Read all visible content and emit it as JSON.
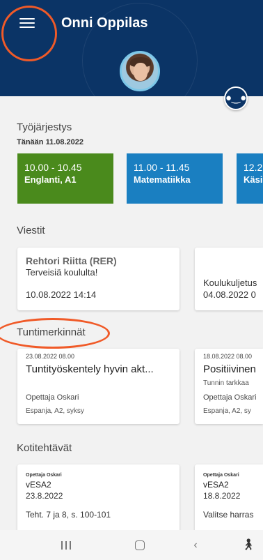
{
  "header": {
    "title": "Onni Oppilas"
  },
  "timetable": {
    "title": "Työjärjestys",
    "subtitle": "Tänään 11.08.2022",
    "lessons": [
      {
        "time": "10.00 - 10.45",
        "subject": "Englanti, A1",
        "color": "#4a8a1c"
      },
      {
        "time": "11.00 - 11.45",
        "subject": "Matematiikka",
        "color": "#1a7fc1"
      },
      {
        "time": "12.2",
        "subject": "Käsi",
        "color": "#1a7fc1"
      }
    ]
  },
  "messages": {
    "title": "Viestit",
    "items": [
      {
        "from": "Rehtori Riitta (RER)",
        "subject": "Terveisiä koululta!",
        "date": "10.08.2022 14:14"
      },
      {
        "from": "",
        "subject": "Koulukuljetus",
        "date": "04.08.2022 0"
      }
    ]
  },
  "marks": {
    "title": "Tuntimerkinnät",
    "items": [
      {
        "date": "23.08.2022 08.00",
        "text": "Tuntityöskentely hyvin akt...",
        "extra": "",
        "teacher": "Opettaja Oskari",
        "course": "Espanja, A2, syksy"
      },
      {
        "date": "18.08.2022 08.00",
        "text": "Positiivinen",
        "extra": "Tunnin tarkkaa",
        "teacher": "Opettaja Oskari",
        "course": "Espanja, A2, sy"
      }
    ]
  },
  "homework": {
    "title": "Kotitehtävät",
    "items": [
      {
        "teacher": "Opettaja Oskari",
        "course": "vESA2",
        "date": "23.8.2022",
        "task": "Teht. 7 ja 8, s. 100-101"
      },
      {
        "teacher": "Opettaja Oskari",
        "course": "vESA2",
        "date": "18.8.2022",
        "task": "Valitse harras"
      }
    ]
  },
  "navbar": {
    "icons": [
      "recent-apps-icon",
      "home-icon",
      "back-icon",
      "accessibility-icon"
    ]
  },
  "colors": {
    "header": "#0b3466",
    "annotation": "#f05a28"
  }
}
